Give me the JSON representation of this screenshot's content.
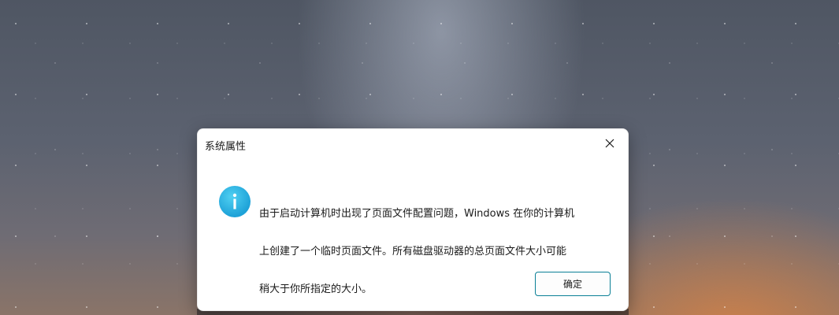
{
  "dialog": {
    "title": "系统属性",
    "message_lines": [
      "由于启动计算机时出现了页面文件配置问题，Windows 在你的计算机",
      "上创建了一个临时页面文件。所有磁盘驱动器的总页面文件大小可能",
      "稍大于你所指定的大小。"
    ],
    "ok_label": "确定",
    "icon": "info-icon",
    "close_icon": "close-icon"
  },
  "colors": {
    "info_icon": "#1ea2d8",
    "button_border": "#0a7f96"
  }
}
